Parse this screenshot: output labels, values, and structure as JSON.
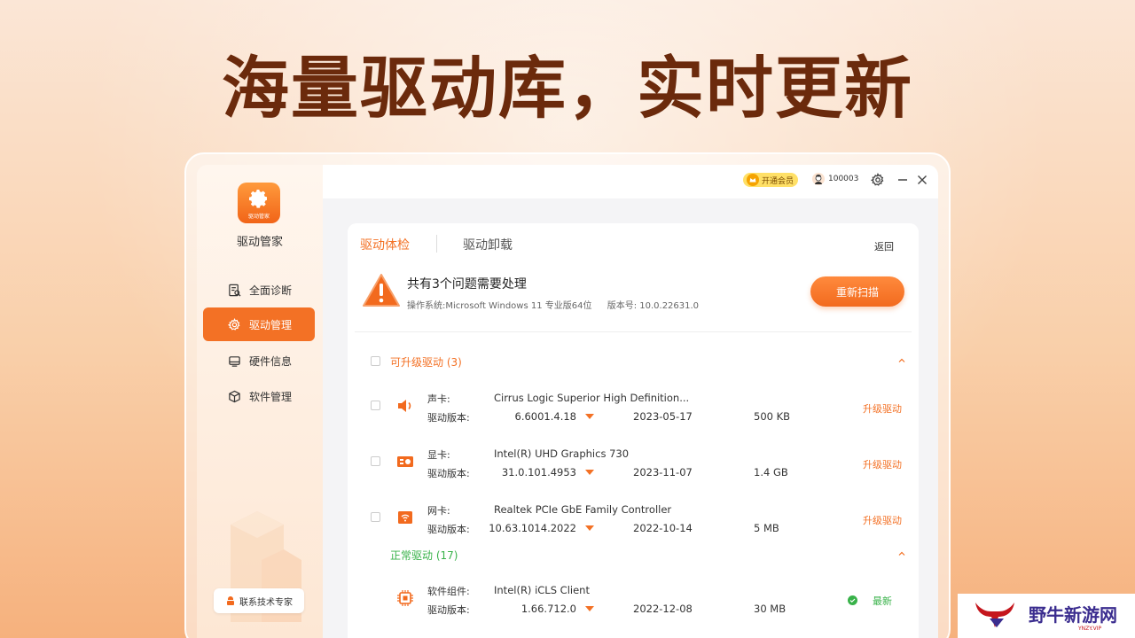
{
  "headline": "海量驱动库，实时更新",
  "app": {
    "logo_tag": "驱动管家",
    "name": "驱动管家"
  },
  "sidebar": {
    "items": [
      {
        "label": "全面诊断",
        "icon": "diagnosis-icon"
      },
      {
        "label": "驱动管理",
        "icon": "gear-icon",
        "active": true
      },
      {
        "label": "硬件信息",
        "icon": "hardware-icon"
      },
      {
        "label": "软件管理",
        "icon": "box-icon"
      }
    ],
    "expert_button": "联系技术专家"
  },
  "titlebar": {
    "vip_label": "开通会员",
    "user_id": "100003"
  },
  "tabs": {
    "active": "驱动体检",
    "second": "驱动卸载",
    "back": "返回"
  },
  "summary": {
    "title": "共有3个问题需要处理",
    "os": "操作系统:Microsoft Windows 11 专业版64位",
    "version": "版本号: 10.0.22631.0",
    "rescan": "重新扫描"
  },
  "sections": {
    "upgradable": "可升级驱动 (3)",
    "normal": "正常驱动 (17)"
  },
  "version_label": "驱动版本:",
  "upgradable_drivers": [
    {
      "category": "声卡:",
      "name": "Cirrus Logic Superior High Definition...",
      "version": "6.6001.4.18",
      "date": "2023-05-17",
      "size": "500 KB",
      "action": "升级驱动"
    },
    {
      "category": "显卡:",
      "name": "Intel(R) UHD Graphics 730",
      "version": "31.0.101.4953",
      "date": "2023-11-07",
      "size": "1.4 GB",
      "action": "升级驱动"
    },
    {
      "category": "网卡:",
      "name": "Realtek PCIe GbE Family Controller",
      "version": "10.63.1014.2022",
      "date": "2022-10-14",
      "size": "5 MB",
      "action": "升级驱动"
    }
  ],
  "normal_drivers": [
    {
      "category": "软件组件:",
      "name": "Intel(R) iCLS Client",
      "version": "1.66.712.0",
      "date": "2022-12-08",
      "size": "30 MB",
      "status": "最新"
    }
  ],
  "watermark": {
    "text": "野牛新游网",
    "sub": "YNZY.VIP"
  },
  "colors": {
    "accent": "#f37125",
    "ok": "#38b249",
    "headline": "#6b2a0c"
  }
}
